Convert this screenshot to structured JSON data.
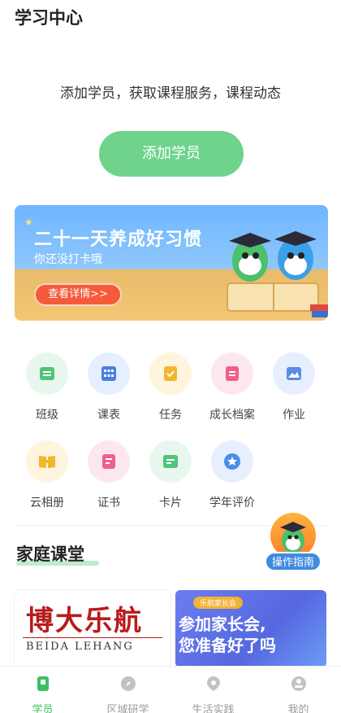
{
  "page_title": "学习中心",
  "add_prompt": "添加学员，获取课程服务，课程动态",
  "add_button": "添加学员",
  "banner": {
    "title": "二十一天养成好习惯",
    "subtitle": "你还没打卡哦",
    "button": "查看详情>>"
  },
  "grid": [
    {
      "label": "班级",
      "icon": "class-icon",
      "color": "#4fc47a",
      "bg": "#e8f7ed"
    },
    {
      "label": "课表",
      "icon": "timetable-icon",
      "color": "#4a7de0",
      "bg": "#e6efff"
    },
    {
      "label": "任务",
      "icon": "task-icon",
      "color": "#f2b62d",
      "bg": "#fff4de"
    },
    {
      "label": "成长档案",
      "icon": "growth-record-icon",
      "color": "#ef5f8a",
      "bg": "#fde7ee"
    },
    {
      "label": "作业",
      "icon": "homework-icon",
      "color": "#5b8ce8",
      "bg": "#e7efff"
    },
    {
      "label": "云相册",
      "icon": "cloud-album-icon",
      "color": "#f2b62d",
      "bg": "#fff4de"
    },
    {
      "label": "证书",
      "icon": "certificate-icon",
      "color": "#ef5f8a",
      "bg": "#fde7ee"
    },
    {
      "label": "卡片",
      "icon": "card-icon",
      "color": "#4fc47a",
      "bg": "#e8f7ed"
    },
    {
      "label": "学年评价",
      "icon": "evaluation-icon",
      "color": "#4a8ee8",
      "bg": "#e7efff"
    }
  ],
  "section_title": "家庭课堂",
  "guide_label": "操作指南",
  "card_left": {
    "title": "博大乐航",
    "subtitle": "BEIDA LEHANG"
  },
  "card_right": {
    "tag": "乐航家长会",
    "line1": "参加家长会,",
    "line2": "您准备好了吗"
  },
  "tabbar": [
    {
      "label": "学员",
      "icon": "student-icon",
      "active": true
    },
    {
      "label": "区域研学",
      "icon": "compass-icon",
      "active": false
    },
    {
      "label": "生活实践",
      "icon": "practice-icon",
      "active": false
    },
    {
      "label": "我的",
      "icon": "profile-icon",
      "active": false
    }
  ],
  "colors": {
    "accent": "#3cbf60",
    "button": "#6fd38b",
    "banner_button": "#f55b3b",
    "guide": "#3f8be0"
  }
}
